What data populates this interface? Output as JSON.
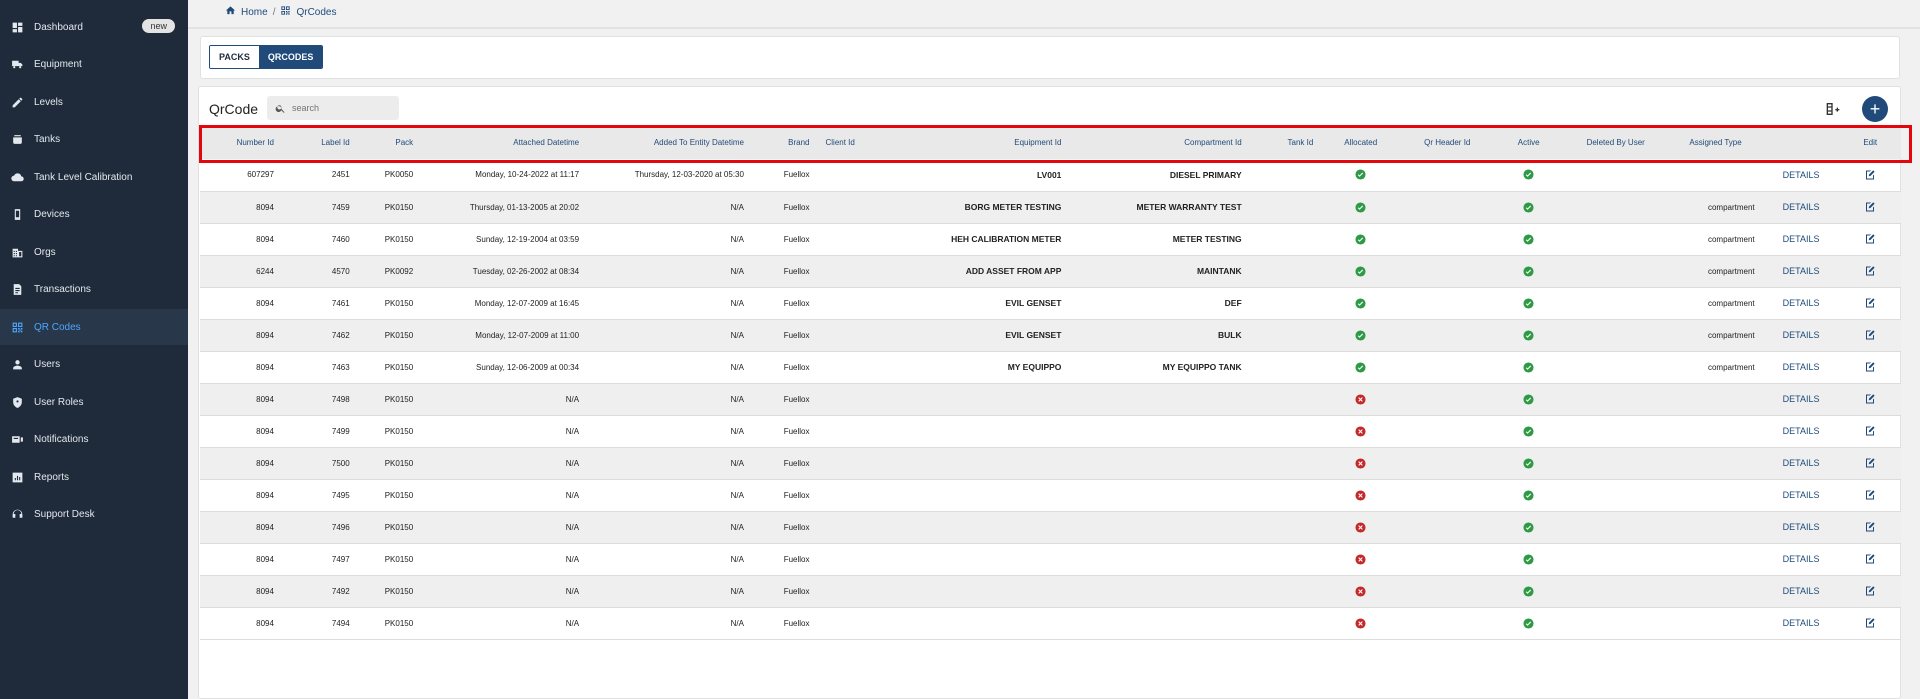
{
  "sidebar": {
    "items": [
      {
        "label": "Dashboard",
        "icon": "dashboard-icon",
        "badge": "new"
      },
      {
        "label": "Equipment",
        "icon": "truck-icon"
      },
      {
        "label": "Levels",
        "icon": "pencil-icon"
      },
      {
        "label": "Tanks",
        "icon": "tank-icon"
      },
      {
        "label": "Tank Level Calibration",
        "icon": "cloud-icon"
      },
      {
        "label": "Devices",
        "icon": "device-icon"
      },
      {
        "label": "Orgs",
        "icon": "building-icon"
      },
      {
        "label": "Transactions",
        "icon": "receipt-icon"
      },
      {
        "label": "QR Codes",
        "icon": "qrcode-icon",
        "active": true
      },
      {
        "label": "Users",
        "icon": "user-icon"
      },
      {
        "label": "User Roles",
        "icon": "shield-icon"
      },
      {
        "label": "Notifications",
        "icon": "notification-icon"
      },
      {
        "label": "Reports",
        "icon": "report-icon"
      },
      {
        "label": "Support Desk",
        "icon": "support-icon"
      }
    ]
  },
  "breadcrumb": {
    "home": "Home",
    "separator": "/",
    "current": "QrCodes"
  },
  "tabs": [
    {
      "label": "PACKS"
    },
    {
      "label": "QRCODES",
      "active": true
    }
  ],
  "panel": {
    "title": "QrCode",
    "search_placeholder": "search"
  },
  "table": {
    "headers": [
      "Number Id",
      "Label Id",
      "Pack",
      "Attached Datetime",
      "Added To Entity Datetime",
      "Brand",
      "Client Id",
      "Equipment Id",
      "Compartment Id",
      "Tank Id",
      "Allocated",
      "Qr Header Id",
      "Active",
      "Deleted By User",
      "Assigned Type",
      "",
      "Edit"
    ],
    "details_label": "DETAILS",
    "rows": [
      {
        "number_id": "607297",
        "label_id": "2451",
        "pack": "PK0050",
        "attached": "Monday, 10-24-2022 at 11:17",
        "added": "Thursday, 12-03-2020 at 05:30",
        "brand": "Fuellox",
        "equipment": "LV001",
        "compartment": "DIESEL PRIMARY",
        "allocated": "check",
        "active": "check",
        "assigned_type": ""
      },
      {
        "number_id": "8094",
        "label_id": "7459",
        "pack": "PK0150",
        "attached": "Thursday, 01-13-2005 at 20:02",
        "added": "N/A",
        "brand": "Fuellox",
        "equipment": "BORG METER TESTING",
        "compartment": "METER WARRANTY TEST",
        "allocated": "check",
        "active": "check",
        "assigned_type": "compartment"
      },
      {
        "number_id": "8094",
        "label_id": "7460",
        "pack": "PK0150",
        "attached": "Sunday, 12-19-2004 at 03:59",
        "added": "N/A",
        "brand": "Fuellox",
        "equipment": "HEH CALIBRATION METER",
        "compartment": "METER TESTING",
        "allocated": "check",
        "active": "check",
        "assigned_type": "compartment"
      },
      {
        "number_id": "6244",
        "label_id": "4570",
        "pack": "PK0092",
        "attached": "Tuesday, 02-26-2002 at 08:34",
        "added": "N/A",
        "brand": "Fuellox",
        "equipment": "ADD ASSET FROM APP",
        "compartment": "MAINTANK",
        "allocated": "check",
        "active": "check",
        "assigned_type": "compartment"
      },
      {
        "number_id": "8094",
        "label_id": "7461",
        "pack": "PK0150",
        "attached": "Monday, 12-07-2009 at 16:45",
        "added": "N/A",
        "brand": "Fuellox",
        "equipment": "EVIL GENSET",
        "compartment": "DEF",
        "allocated": "check",
        "active": "check",
        "assigned_type": "compartment"
      },
      {
        "number_id": "8094",
        "label_id": "7462",
        "pack": "PK0150",
        "attached": "Monday, 12-07-2009 at 11:00",
        "added": "N/A",
        "brand": "Fuellox",
        "equipment": "EVIL GENSET",
        "compartment": "BULK",
        "allocated": "check",
        "active": "check",
        "assigned_type": "compartment"
      },
      {
        "number_id": "8094",
        "label_id": "7463",
        "pack": "PK0150",
        "attached": "Sunday, 12-06-2009 at 00:34",
        "added": "N/A",
        "brand": "Fuellox",
        "equipment": "MY EQUIPPO",
        "compartment": "MY EQUIPPO TANK",
        "allocated": "check",
        "active": "check",
        "assigned_type": "compartment"
      },
      {
        "number_id": "8094",
        "label_id": "7498",
        "pack": "PK0150",
        "attached": "N/A",
        "added": "N/A",
        "brand": "Fuellox",
        "equipment": "",
        "compartment": "",
        "allocated": "cross",
        "active": "check",
        "assigned_type": ""
      },
      {
        "number_id": "8094",
        "label_id": "7499",
        "pack": "PK0150",
        "attached": "N/A",
        "added": "N/A",
        "brand": "Fuellox",
        "equipment": "",
        "compartment": "",
        "allocated": "cross",
        "active": "check",
        "assigned_type": ""
      },
      {
        "number_id": "8094",
        "label_id": "7500",
        "pack": "PK0150",
        "attached": "N/A",
        "added": "N/A",
        "brand": "Fuellox",
        "equipment": "",
        "compartment": "",
        "allocated": "cross",
        "active": "check",
        "assigned_type": ""
      },
      {
        "number_id": "8094",
        "label_id": "7495",
        "pack": "PK0150",
        "attached": "N/A",
        "added": "N/A",
        "brand": "Fuellox",
        "equipment": "",
        "compartment": "",
        "allocated": "cross",
        "active": "check",
        "assigned_type": ""
      },
      {
        "number_id": "8094",
        "label_id": "7496",
        "pack": "PK0150",
        "attached": "N/A",
        "added": "N/A",
        "brand": "Fuellox",
        "equipment": "",
        "compartment": "",
        "allocated": "cross",
        "active": "check",
        "assigned_type": ""
      },
      {
        "number_id": "8094",
        "label_id": "7497",
        "pack": "PK0150",
        "attached": "N/A",
        "added": "N/A",
        "brand": "Fuellox",
        "equipment": "",
        "compartment": "",
        "allocated": "cross",
        "active": "check",
        "assigned_type": ""
      },
      {
        "number_id": "8094",
        "label_id": "7492",
        "pack": "PK0150",
        "attached": "N/A",
        "added": "N/A",
        "brand": "Fuellox",
        "equipment": "",
        "compartment": "",
        "allocated": "cross",
        "active": "check",
        "assigned_type": ""
      },
      {
        "number_id": "8094",
        "label_id": "7494",
        "pack": "PK0150",
        "attached": "N/A",
        "added": "N/A",
        "brand": "Fuellox",
        "equipment": "",
        "compartment": "",
        "allocated": "cross",
        "active": "check",
        "assigned_type": ""
      }
    ]
  },
  "colors": {
    "sidebar_bg": "#1f2b3a",
    "accent": "#1f4a7a",
    "active_link": "#4ea6ff",
    "check": "#2e9a46",
    "cross": "#c62828",
    "highlight": "#e3060c"
  }
}
